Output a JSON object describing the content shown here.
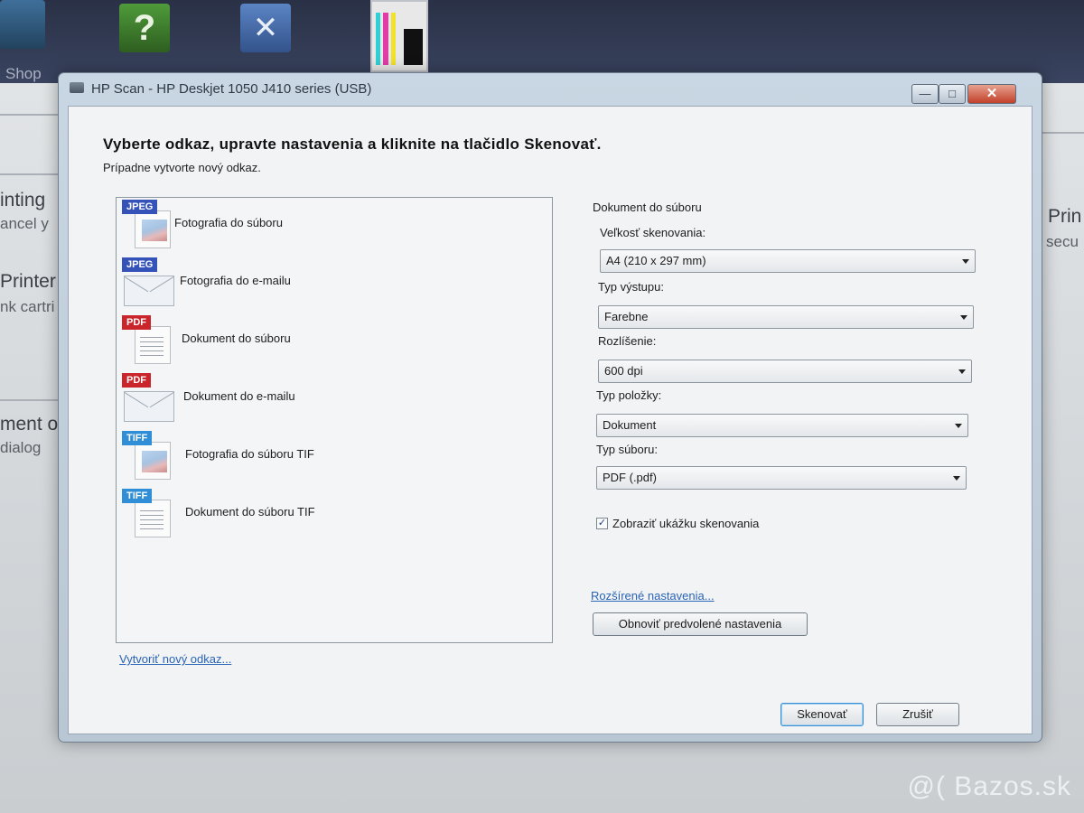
{
  "background": {
    "shop_label": "Shop",
    "text_fragments": [
      "inting",
      "ancel y",
      "Printer",
      "nk cartri",
      "ment or",
      "dialog",
      "Prin",
      "secu"
    ],
    "ink_colors": [
      "#2fd1d6",
      "#e03da6",
      "#f2e22b",
      "#111111"
    ],
    "watermark": "@( Bazos.sk"
  },
  "window": {
    "title": "HP Scan - HP Deskjet 1050 J410 series (USB)",
    "min_label": "—",
    "max_label": "□",
    "close_label": "✕"
  },
  "header": {
    "title": "Vyberte odkaz, upravte nastavenia a kliknite na tlačidlo Skenovať.",
    "subtitle": "Prípadne vytvorte nový odkaz."
  },
  "shortcuts": [
    {
      "badge": "JPEG",
      "type": "photo-file",
      "label": "Fotografia do súboru"
    },
    {
      "badge": "JPEG",
      "type": "photo-mail",
      "label": "Fotografia do e-mailu"
    },
    {
      "badge": "PDF",
      "type": "doc-file",
      "label": "Dokument do súboru"
    },
    {
      "badge": "PDF",
      "type": "doc-mail",
      "label": "Dokument do e-mailu"
    },
    {
      "badge": "TIFF",
      "type": "photo-file",
      "label": "Fotografia do súboru TIF"
    },
    {
      "badge": "TIFF",
      "type": "doc-file",
      "label": "Dokument do súboru TIF"
    }
  ],
  "create_link": "Vytvoriť nový odkaz...",
  "settings": {
    "group_title": "Dokument do súboru",
    "scan_size_label": "Veľkosť skenovania:",
    "scan_size_value": "A4 (210 x 297 mm)",
    "output_type_label": "Typ výstupu:",
    "output_type_value": "Farebne",
    "resolution_label": "Rozlíšenie:",
    "resolution_value": "600 dpi",
    "item_type_label": "Typ položky:",
    "item_type_value": "Dokument",
    "file_type_label": "Typ súboru:",
    "file_type_value": "PDF (.pdf)",
    "preview_checkbox_label": "Zobraziť ukážku skenovania",
    "preview_checked": true,
    "advanced_link": "Rozšírené nastavenia...",
    "reset_button": "Obnoviť predvolené nastavenia"
  },
  "buttons": {
    "scan": "Skenovať",
    "cancel": "Zrušiť"
  },
  "colors": {
    "badge_jpeg": "#3452b8",
    "badge_pdf": "#c9252b",
    "badge_tif": "#2f8ed6",
    "link": "#2a64b5"
  }
}
